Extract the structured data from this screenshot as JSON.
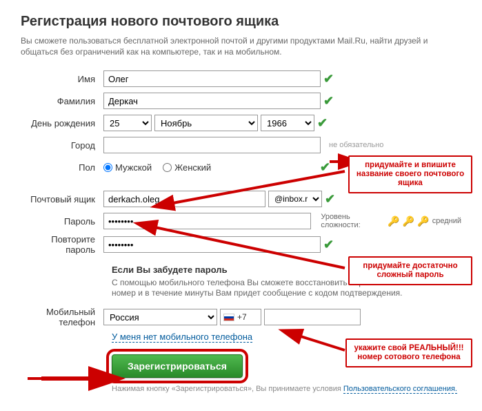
{
  "header": {
    "title": "Регистрация нового почтового ящика",
    "subtitle": "Вы сможете пользоваться бесплатной электронной почтой и другими продуктами Mail.Ru, найти друзей и общаться без ограничений как на компьютере, так и на мобильном."
  },
  "labels": {
    "name": "Имя",
    "surname": "Фамилия",
    "birthday": "День рождения",
    "city": "Город",
    "gender": "Пол",
    "mailbox": "Почтовый ящик",
    "password": "Пароль",
    "repeat_password": "Повторите пароль",
    "mobile": "Мобильный телефон"
  },
  "values": {
    "name": "Олег",
    "surname": "Деркач",
    "day": "25",
    "month": "Ноябрь",
    "year": "1966",
    "city": "",
    "gender_male": "Мужской",
    "gender_female": "Женский",
    "mailbox": "derkach.oleg",
    "domain": "@inbox.ru",
    "password": "●●●●●●●●",
    "repeat_password": "●●●●●●●●",
    "country": "Россия",
    "code": "+7",
    "phone": ""
  },
  "misc": {
    "optional": "не обязательно",
    "complexity_label": "Уровень сложности:",
    "complexity_value": "средний",
    "forgot_header": "Если Вы забудете пароль",
    "forgot_desc": "С помощью мобильного телефона Вы сможете восстановить пароль. Укажите номер и в течение минуты Вам придет сообщение с кодом подтверждения.",
    "no_phone_link": "У меня нет мобильного телефона",
    "register_btn": "Зарегистрироваться",
    "terms_prefix": "Нажимая кнопку «Зарегистрироваться», Вы принимаете условия ",
    "terms_link": "Пользовательского соглашения."
  },
  "annotations": {
    "a1": "придумайте и впишите название своего почтового ящика",
    "a2": "придумайте достаточно сложный пароль",
    "a3": "укажите свой РЕАЛЬНЫЙ!!! номер сотового телефона"
  }
}
